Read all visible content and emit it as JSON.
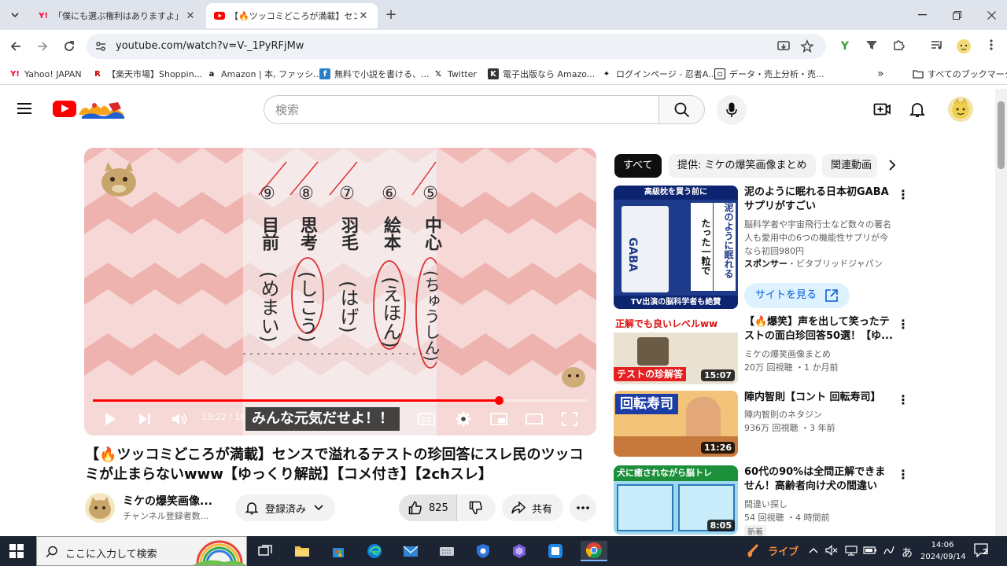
{
  "browser": {
    "tabs": [
      {
        "title": "「僕にも選ぶ権利はありますよ」中日",
        "active": false
      },
      {
        "title": "【🔥ツッコミどころが満載】センスで溢",
        "active": true
      }
    ],
    "url": "youtube.com/watch?v=V-_1PyRFjMw",
    "bookmarks": [
      {
        "label": "Yahoo! JAPAN",
        "icon": "Y!"
      },
      {
        "label": "【楽天市場】Shoppin...",
        "icon": "R"
      },
      {
        "label": "Amazon | 本, ファッシ...",
        "icon": "a"
      },
      {
        "label": "無料で小説を書ける、...",
        "icon": "f"
      },
      {
        "label": "Twitter",
        "icon": "X"
      },
      {
        "label": "電子出版なら Amazo...",
        "icon": "K"
      },
      {
        "label": "ログインページ - 忍者A...",
        "icon": "N"
      },
      {
        "label": "データ・売上分析・売...",
        "icon": "D"
      }
    ],
    "all_bookmarks": "すべてのブックマーク"
  },
  "youtube": {
    "search_placeholder": "検索",
    "player": {
      "current_time": "13:22",
      "duration": "16:18",
      "time_display": "13:22 / 16:18",
      "progress_fraction": 0.82,
      "subtitle": "みんな元気だせよ！！",
      "paper_columns": [
        {
          "num": "⑨",
          "kanji": "目前",
          "answer": "(めまい)"
        },
        {
          "num": "⑧",
          "kanji": "思考",
          "answer": "(しこう)"
        },
        {
          "num": "⑦",
          "kanji": "羽毛",
          "answer": "(はげ)"
        },
        {
          "num": "⑥",
          "kanji": "絵本",
          "answer": "(えほん)"
        },
        {
          "num": "⑤",
          "kanji": "中心",
          "answer": "(ちゅうしん)"
        }
      ]
    },
    "video_title": "【🔥ツッコミどころが満載】センスで溢れるテストの珍回答にスレ民のツッコミが止まらないwww【ゆっくり解説】【コメ付き】【2chスレ】",
    "channel": {
      "name": "ミケの爆笑画像...",
      "subs": "チャンネル登録者数..."
    },
    "subscribe_label": "登録済み",
    "like_count": "825",
    "share_label": "共有",
    "chips": [
      "すべて",
      "提供: ミケの爆笑画像まとめ",
      "関連動画"
    ],
    "ad": {
      "title": "泥のように眠れる日本初GABAサプリがすごい",
      "desc": "脳科学者や宇宙飛行士など数々の著名人も愛用中の6つの機能性サプリが今なら初回980円",
      "sponsor_label": "スポンサー",
      "sponsor_name": "・ビタブリッドジャパン",
      "cta": "サイトを見る",
      "thumb_top": "高級枕を買う前に",
      "thumb_right": "たった一粒で",
      "thumb_right2": "泥のように眠れる",
      "thumb_caption": "TV出演の脳科学者も絶賛",
      "thumb_brand": "GABA"
    },
    "recommendations": [
      {
        "title": "【🔥爆笑】声を出して笑ったテストの面白珍回答50選！【ゆ...",
        "channel": "ミケの爆笑画像まとめ",
        "meta": "20万 回視聴 ・1 か月前",
        "duration": "15:07",
        "thumb_text": "正解でも良いレベルww",
        "thumb_text2": "テストの珍解答"
      },
      {
        "title": "陣内智則【コント 回転寿司】",
        "channel": "陣内智則のネタジン",
        "meta": "936万 回視聴 ・3 年前",
        "duration": "11:26",
        "thumb_text": "回転寿司"
      },
      {
        "title": "60代の90%は全問正解できません！高齢者向け犬の間違い探...",
        "channel": "間違い探し",
        "meta": "54 回視聴 ・4 時間前",
        "duration": "8:05",
        "thumb_text": "犬に癒されながら脳トレ",
        "badge": "新着"
      }
    ]
  },
  "taskbar": {
    "search_placeholder": "ここに入力して検索",
    "live_label": "ライブ",
    "ime": "あ",
    "time": "14:06",
    "date": "2024/09/14",
    "notif_count": "2"
  },
  "colors": {
    "yt_red": "#ff0000",
    "accent_blue": "#065fd4",
    "taskbar": "#1c2433",
    "tab_strip": "#dfe3eb"
  }
}
